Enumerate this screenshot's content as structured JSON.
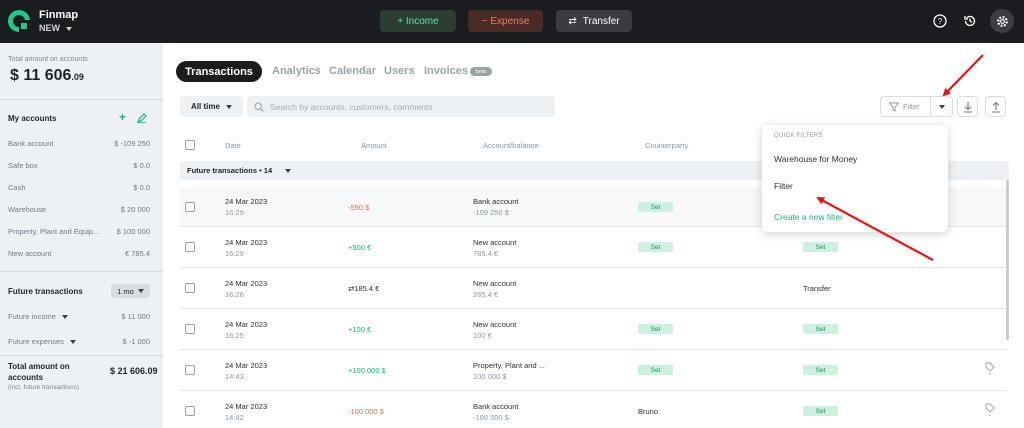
{
  "topbar": {
    "brand": "Finmap",
    "workspace": "NEW",
    "income_label": "+ Income",
    "expense_label": "− Expense",
    "transfer_label": "Transfer",
    "icons": [
      "help-icon",
      "history-icon",
      "settings-icon"
    ]
  },
  "sidebar": {
    "total_label": "Total amount on accounts",
    "total_main": "$ 11 606",
    "total_cents": ".09",
    "my_accounts": "My accounts",
    "accounts": [
      {
        "name": "Bank account",
        "value": "$ -109 250"
      },
      {
        "name": "Safe box",
        "value": "$ 0.0"
      },
      {
        "name": "Cash",
        "value": "$ 0.0"
      },
      {
        "name": "Warehouse",
        "value": "$ 20 000"
      },
      {
        "name": "Property, Plant and Equip...",
        "value": "$ 100 000"
      },
      {
        "name": "New account",
        "value": "€ 785.4"
      }
    ],
    "future_transactions": "Future transactions",
    "period": "1 mo",
    "future_income": "Future income",
    "future_income_value": "$ 11 000",
    "future_expenses": "Future expenses",
    "future_expenses_value": "$ -1 000",
    "total_future_label": "Total amount on accounts",
    "total_future_value": "$ 21 606.09",
    "total_future_note": "(incl. future transactions)"
  },
  "tabs": {
    "active": "Transactions",
    "items": [
      "Analytics",
      "Calendar",
      "Users",
      "Invoices"
    ],
    "beta": "beta"
  },
  "toolbar": {
    "period": "All time",
    "search_placeholder": "Search by accounts, customers, comments",
    "filter_label": "Filter"
  },
  "table": {
    "headers": {
      "date": "Date",
      "amount": "Amount",
      "account": "Account/balance",
      "counterparty": "Counterparty"
    },
    "group_label": "Future transactions • 14",
    "set_label": "Set",
    "rows": [
      {
        "date": "24 Mar 2023",
        "time": "16:29",
        "amount": "-550  $",
        "type": "neg",
        "account": "Bank account",
        "balance": "-109 250  $",
        "counterparty": "",
        "category": ""
      },
      {
        "date": "24 Mar 2023",
        "time": "16:29",
        "amount": "+500 €",
        "type": "pos",
        "account": "New account",
        "balance": "785.4 €",
        "counterparty": "",
        "category": ""
      },
      {
        "date": "24 Mar 2023",
        "time": "16:26",
        "amount": "⇄185.4 €",
        "type": "transfer",
        "account": "New account",
        "balance": "285.4 €",
        "counterparty": "",
        "category": "Transfer"
      },
      {
        "date": "24 Mar 2023",
        "time": "16:25",
        "amount": "+100 €",
        "type": "pos",
        "account": "New account",
        "balance": "100 €",
        "counterparty": "",
        "category": ""
      },
      {
        "date": "24 Mar 2023",
        "time": "14:43",
        "amount": "+100 000  $",
        "type": "pos",
        "account": "Property, Plant and ...",
        "balance": "100 000  $",
        "counterparty": "",
        "category": ""
      },
      {
        "date": "24 Mar 2023",
        "time": "14:42",
        "amount": "-100 000  $",
        "type": "neg",
        "account": "Bank account",
        "balance": "-108 500  $",
        "counterparty": "Bruno",
        "category": ""
      }
    ]
  },
  "dropdown": {
    "header": "QUICK FILTERS",
    "items": [
      "Warehouse for Money",
      "Filter"
    ],
    "create": "Create a new filter"
  },
  "colors": {
    "accent": "#18b67a",
    "negative": "#f06a4f",
    "annotation": "#e8141b",
    "topbar": "#1b1c1f"
  }
}
